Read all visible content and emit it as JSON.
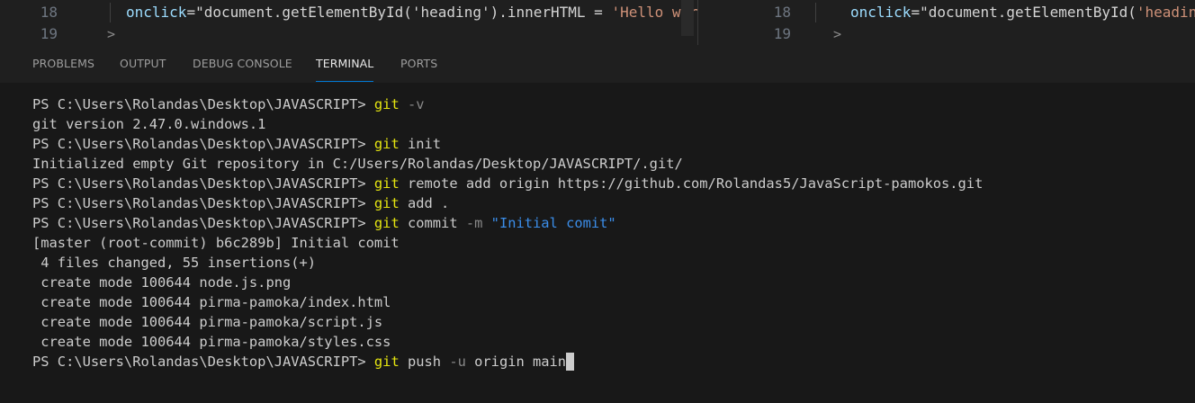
{
  "editor": {
    "left_pane": {
      "lines": [
        {
          "number": "18",
          "attr": "onclick",
          "eq": "=\"",
          "call": "document.getElementById('heading').innerHTML = ",
          "string": "'Hello wor"
        },
        {
          "number": "19",
          "chevron": ">"
        }
      ]
    },
    "right_pane": {
      "lines": [
        {
          "number": "18",
          "attr": "onclick",
          "eq": "=\"",
          "call": "document.getElementById(",
          "string": "'headin"
        },
        {
          "number": "19",
          "chevron": ">"
        }
      ]
    }
  },
  "panel": {
    "tabs": [
      {
        "label": "PROBLEMS",
        "active": false
      },
      {
        "label": "OUTPUT",
        "active": false
      },
      {
        "label": "DEBUG CONSOLE",
        "active": false
      },
      {
        "label": "TERMINAL",
        "active": true
      },
      {
        "label": "PORTS",
        "active": false
      }
    ]
  },
  "terminal": {
    "prompt": "PS C:\\Users\\Rolandas\\Desktop\\JAVASCRIPT> ",
    "lines": [
      {
        "type": "cmd",
        "git": "git",
        "flag": " -v",
        "rest": ""
      },
      {
        "type": "out",
        "text": "git version 2.47.0.windows.1"
      },
      {
        "type": "cmd",
        "git": "git",
        "flag": "",
        "rest": " init"
      },
      {
        "type": "out",
        "text": "Initialized empty Git repository in C:/Users/Rolandas/Desktop/JAVASCRIPT/.git/"
      },
      {
        "type": "cmd",
        "git": "git",
        "flag": "",
        "rest": " remote add origin https://github.com/Rolandas5/JavaScript-pamokos.git"
      },
      {
        "type": "cmd",
        "git": "git",
        "flag": "",
        "rest": " add ."
      },
      {
        "type": "cmd",
        "git": "git",
        "flag": "",
        "rest": " commit",
        "flag2": " -m",
        "str": " \"Initial comit\""
      },
      {
        "type": "out",
        "text": "[master (root-commit) b6c289b] Initial comit"
      },
      {
        "type": "out",
        "text": " 4 files changed, 55 insertions(+)"
      },
      {
        "type": "out",
        "text": " create mode 100644 node.js.png"
      },
      {
        "type": "out",
        "text": " create mode 100644 pirma-pamoka/index.html"
      },
      {
        "type": "out",
        "text": " create mode 100644 pirma-pamoka/script.js"
      },
      {
        "type": "out",
        "text": " create mode 100644 pirma-pamoka/styles.css"
      },
      {
        "type": "cmd",
        "git": "git",
        "flag": "",
        "rest": " push",
        "flag2": " -u",
        "rest2": " origin main",
        "cursor": true
      }
    ]
  },
  "colors": {
    "terminal_bg": "#181818",
    "git_keyword": "#e5e510",
    "string": "#3b8eea",
    "active_tab_underline": "#0078d4"
  }
}
